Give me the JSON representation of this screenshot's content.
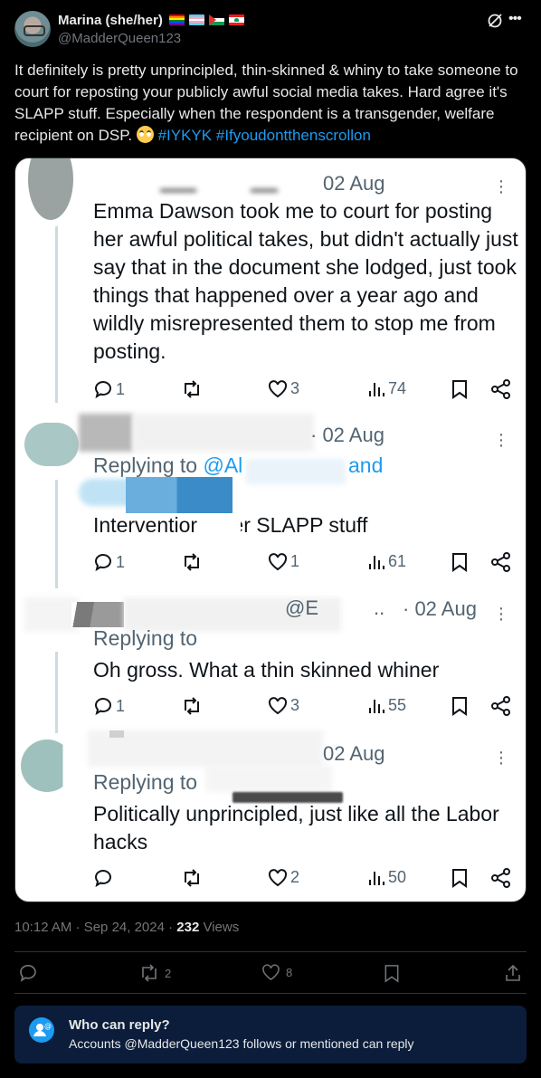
{
  "author": {
    "display_name": "Marina (she/her)",
    "handle": "@MadderQueen123",
    "flags": [
      "rainbow-flag",
      "transgender-flag",
      "palestine-flag",
      "lebanon-flag"
    ]
  },
  "post": {
    "text_main": "It definitely is pretty unprincipled, thin-skinned & whiny to take someone to court for reposting your publicly awful social media takes. Hard agree it's SLAPP stuff. Especially when the respondent is a transgender, welfare recipient on DSP.",
    "emoji": "face-with-rolling-eyes",
    "hashtag_1": "#IYKYK",
    "hashtag_2": "#Ifyoudontthenscrollon"
  },
  "media": {
    "posts": [
      {
        "date": "02 Aug",
        "text": "Emma Dawson took me to court for posting her awful political takes, but didn't actually just say that in the document she lodged, just took things that happened over a year ago and wildly misrepresented them to stop me from posting.",
        "replies": "1",
        "likes": "3",
        "views": "74"
      },
      {
        "date": "· 02 Aug",
        "replying_prefix": "Replying to ",
        "replying_at": "@Al",
        "replying_end": "and",
        "text": "Interventior    der SLAPP stuff",
        "replies": "1",
        "likes": "1",
        "views": "61"
      },
      {
        "handle_fragment": "@E",
        "date": "· 02 Aug",
        "replying_prefix": "Replying to",
        "text": "Oh gross. What a thin skinned whiner",
        "replies": "1",
        "likes": "3",
        "views": "55"
      },
      {
        "date": "02 Aug",
        "replying_prefix": "Replying to",
        "text": "Politically unprincipled, just like all the Labor hacks",
        "replies": "",
        "likes": "2",
        "views": "50"
      }
    ]
  },
  "meta": {
    "time": "10:12 AM · Sep 24, 2024 · ",
    "views_count": "232",
    "views_label": " Views"
  },
  "actions": {
    "replies": "",
    "reposts": "2",
    "likes": "8"
  },
  "who_can_reply": {
    "title": "Who can reply?",
    "subtitle": "Accounts @MadderQueen123 follows or mentioned can reply"
  }
}
